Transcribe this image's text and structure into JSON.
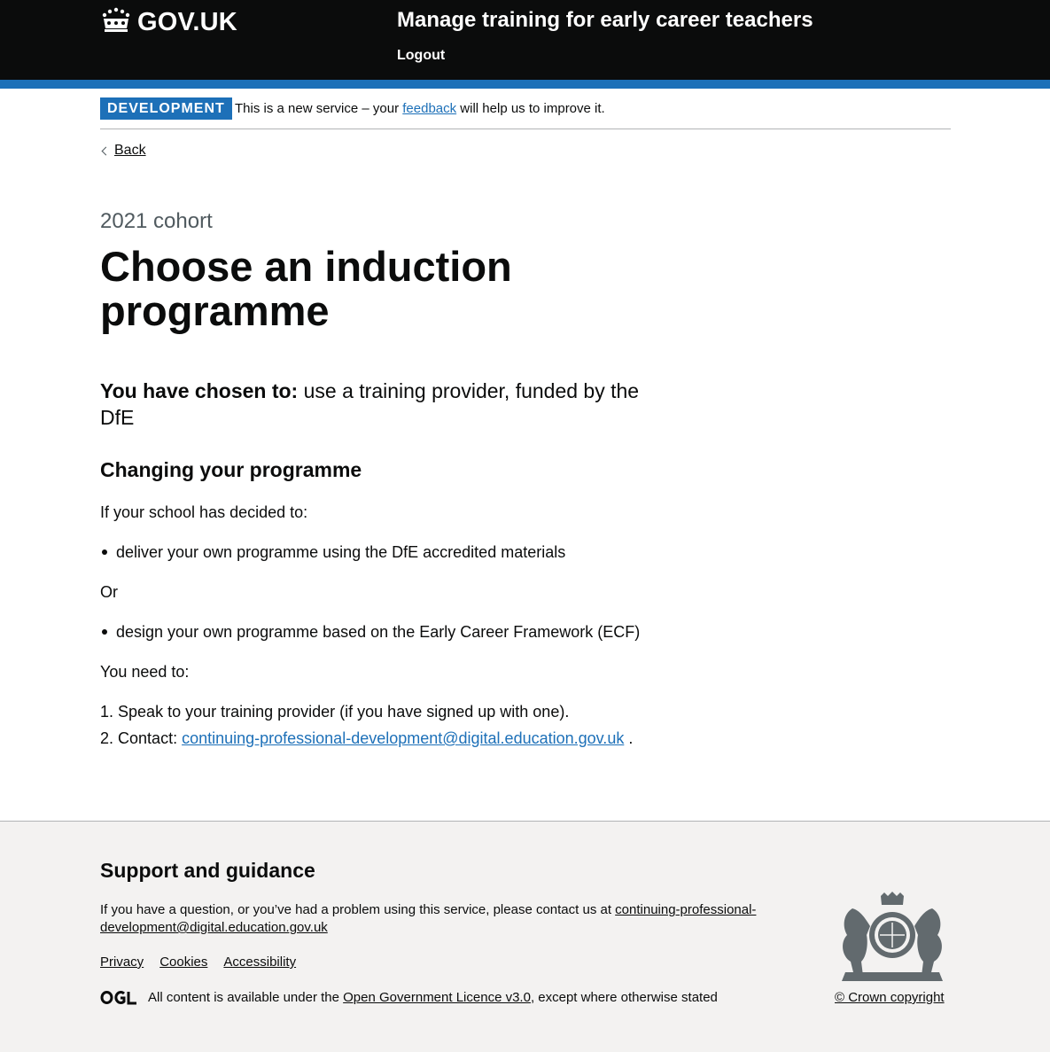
{
  "header": {
    "logo_text": "GOV.UK",
    "service_name": "Manage training for early career teachers",
    "logout_label": "Logout"
  },
  "phase_banner": {
    "tag": "DEVELOPMENT",
    "text_before": "This is a new service – your ",
    "link_text": "feedback",
    "text_after": " will help us to improve it."
  },
  "back_link": "Back",
  "main": {
    "caption": "2021 cohort",
    "title": "Choose an induction programme",
    "chosen_label": "You have chosen to:",
    "chosen_value": " use a training provider, funded by the DfE",
    "changing_heading": "Changing your programme",
    "intro": "If your school has decided to:",
    "option_1": "deliver your own programme using the DfE accredited materials",
    "or": "Or",
    "option_2": "design your own programme based on the Early Career Framework (ECF)",
    "you_need_to": "You need to:",
    "step_1_number": "1.",
    "step_1": "Speak to your training provider (if you have signed up with one).",
    "step_2_number": "2.",
    "step_2_prefix": "Contact: ",
    "step_2_email": "continuing-professional-development@digital.education.gov.uk",
    "step_2_suffix": " ."
  },
  "footer": {
    "title": "Support and guidance",
    "text": "If you have a question, or you’ve had a problem using this service, please contact us at ",
    "email": "continuing-professional-development@digital.education.gov.uk",
    "links": [
      "Privacy",
      "Cookies",
      "Accessibility"
    ],
    "licence_before": "All content is available under the ",
    "licence_link": "Open Government Licence v3.0",
    "licence_after": ", except where otherwise stated",
    "ogl_label": "OGL",
    "copyright": "© Crown copyright"
  },
  "colors": {
    "header_bg": "#0b0c0c",
    "brand_blue": "#1d70b8",
    "footer_bg": "#f3f2f1",
    "secondary_text": "#505a5f"
  }
}
